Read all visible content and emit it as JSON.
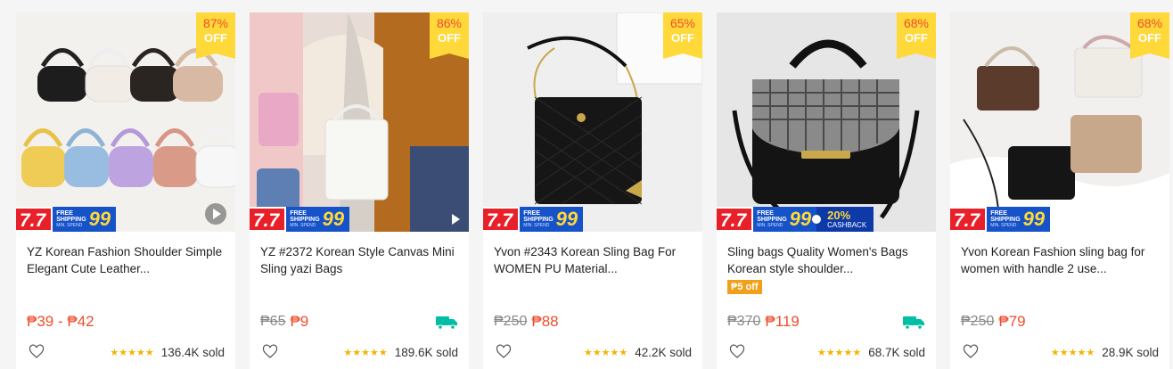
{
  "currency_symbol": "₱",
  "banner": {
    "sale_label": "7.7",
    "free": "FREE",
    "shipping": "SHIPPING",
    "min_spend": "MIN. SPEND",
    "amount": "99",
    "cashback_pct": "20%",
    "cashback_label": "CASHBACK"
  },
  "products": [
    {
      "discount_pct": "87%",
      "discount_off": "OFF",
      "title": "YZ Korean Fashion Shoulder Simple Elegant Cute Leather...",
      "price_old": "",
      "price_new": "₱39 - ₱42",
      "stars": "★★★★★",
      "sold": "136.4K sold",
      "free_ship_icon": false,
      "video_icon": "play-circle",
      "cashback": false,
      "voucher": ""
    },
    {
      "discount_pct": "86%",
      "discount_off": "OFF",
      "title": "YZ #2372 Korean Style Canvas Mini Sling yazi Bags",
      "price_old": "₱65",
      "price_new": "₱9",
      "stars": "★★★★★",
      "sold": "189.6K sold",
      "free_ship_icon": true,
      "video_icon": "play-triangle",
      "cashback": false,
      "voucher": ""
    },
    {
      "discount_pct": "65%",
      "discount_off": "OFF",
      "title": "Yvon #2343 Korean Sling Bag For WOMEN PU Material...",
      "price_old": "₱250",
      "price_new": "₱88",
      "stars": "★★★★★",
      "sold": "42.2K sold",
      "free_ship_icon": false,
      "video_icon": "",
      "cashback": false,
      "voucher": ""
    },
    {
      "discount_pct": "68%",
      "discount_off": "OFF",
      "title": "Sling bags Quality Women's Bags Korean style shoulder...",
      "price_old": "₱370",
      "price_new": "₱119",
      "stars": "★★★★★",
      "sold": "68.7K sold",
      "free_ship_icon": true,
      "video_icon": "",
      "cashback": true,
      "voucher": "₱5 off"
    },
    {
      "discount_pct": "68%",
      "discount_off": "OFF",
      "title": "Yvon Korean Fashion sling bag for women with handle 2 use...",
      "price_old": "₱250",
      "price_new": "₱79",
      "stars": "★★★★★",
      "sold": "28.9K sold",
      "free_ship_icon": false,
      "video_icon": "",
      "cashback": false,
      "voucher": ""
    }
  ],
  "colors": {
    "accent": "#ee4d2d",
    "badge_yellow": "#ffd839",
    "promo_red": "#e8202a",
    "promo_blue": "#1652c8",
    "star": "#f5b301",
    "free_ship_green": "#00bfa5"
  },
  "icons": {
    "heart": "heart-outline-icon",
    "truck": "free-shipping-truck-icon",
    "play": "play-icon"
  }
}
